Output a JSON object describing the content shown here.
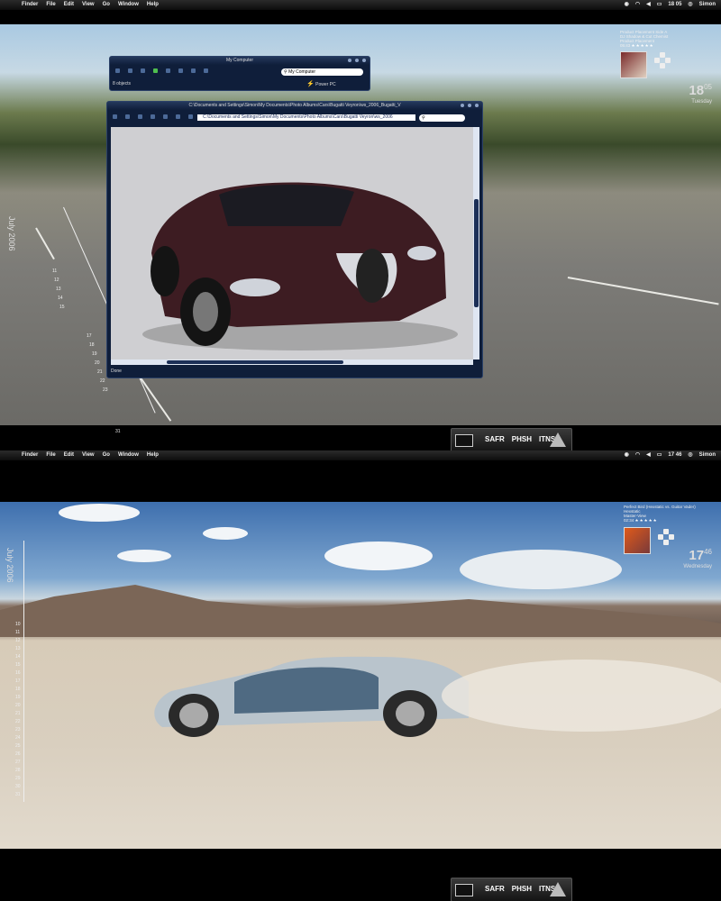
{
  "menubar": {
    "apple_glyph": "",
    "items": [
      "Finder",
      "File",
      "Edit",
      "View",
      "Go",
      "Window",
      "Help"
    ],
    "top_time": "18 05",
    "bottom_time": "17 46",
    "user": "Simon"
  },
  "dock": {
    "apps": [
      "SAFR",
      "PHSH",
      "ITNS"
    ]
  },
  "my_computer": {
    "title": "My Computer",
    "search_value": "My Computer",
    "status": "8 objects",
    "label": "Power PC"
  },
  "browser": {
    "title": "C:\\Documents and Settings\\Simon\\My Documents\\Photo Albums\\Cars\\Bugatti Veyron\\ws_2006_Bugatti_V",
    "path": "C:\\Documents and Settings\\Simon\\My Documents\\Photo Albums\\Cars\\Bugatti Veyron\\ws_2006",
    "status": "Done"
  },
  "top_calendar": {
    "month": "July 2006",
    "nums_left": [
      "11",
      "12",
      "13",
      "14",
      "15"
    ],
    "nums_right": [
      "17",
      "18",
      "19",
      "20",
      "21",
      "22",
      "23"
    ],
    "last": "31"
  },
  "bottom_calendar": {
    "month": "July 2006",
    "nums": [
      "10",
      "11",
      "12",
      "13",
      "14",
      "15",
      "16",
      "17",
      "18",
      "19",
      "20",
      "21",
      "22",
      "23",
      "24",
      "25",
      "26",
      "27",
      "28",
      "29",
      "30",
      "31"
    ]
  },
  "top_widget": {
    "track": "Product Placement Side A",
    "artist": "DJ Shadow & Cut Chemist",
    "album": "Product Placement",
    "time": "05:43",
    "stars": "★★★★★"
  },
  "bottom_widget": {
    "track": "Perfect Bird (Hexstatic vs. Guitar Vader)",
    "artist": "Hexstatic",
    "album": "Master-View",
    "time": "02:34",
    "stars": "★★★★★"
  },
  "top_clock": {
    "hour": "18",
    "minute": "05",
    "day": "Tuesday"
  },
  "bottom_clock": {
    "hour": "17",
    "minute": "46",
    "day": "Wednesday"
  },
  "colors": {
    "window_bg": "#0f1e3a",
    "window_border": "#2b4168",
    "car_top": "#3d1c22",
    "car_bottom": "#b9c4cc"
  }
}
